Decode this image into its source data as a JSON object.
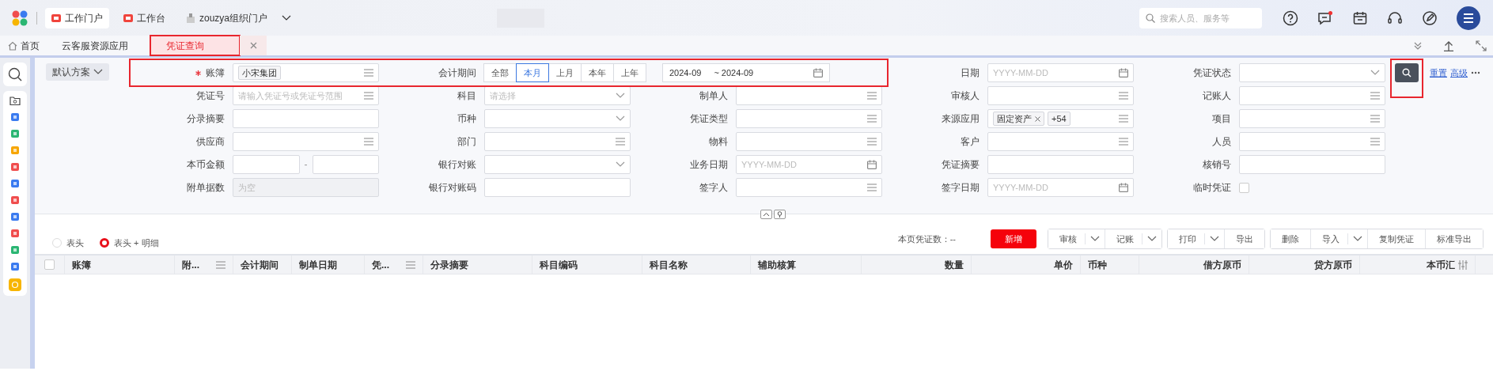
{
  "top_bar": {
    "portals": [
      {
        "label": "工作门户",
        "kind": "app",
        "selected": true
      },
      {
        "label": "工作台",
        "kind": "app",
        "selected": false
      },
      {
        "label": "zouzya组织门户",
        "kind": "org",
        "selected": false
      }
    ],
    "search": {
      "placeholder": "搜索人员、服务等"
    },
    "messages_unread": true
  },
  "tabs": [
    {
      "label": "首页",
      "kind": "home",
      "selected": false,
      "highlighted": false,
      "closable": false
    },
    {
      "label": "云客服资源应用",
      "kind": "page",
      "selected": false,
      "highlighted": false,
      "closable": false
    },
    {
      "label": "凭证查询",
      "kind": "page",
      "selected": true,
      "highlighted": true,
      "closable": true
    }
  ],
  "scheme": {
    "label": "默认方案"
  },
  "filters": [
    {
      "label": "账簿",
      "kind": "list",
      "required": true,
      "highlighted": true,
      "tags": [
        "小宋集团"
      ]
    },
    {
      "label": "会计期间",
      "kind": "period",
      "highlighted": true,
      "options": [
        {
          "label": "全部",
          "selected": false
        },
        {
          "label": "本月",
          "selected": true
        },
        {
          "label": "上月",
          "selected": false
        },
        {
          "label": "本年",
          "selected": false
        },
        {
          "label": "上年",
          "selected": false
        }
      ],
      "from": "2024-09",
      "separator": "~",
      "to": "2024-09"
    },
    {
      "label": "日期",
      "kind": "date",
      "placeholder": "YYYY-MM-DD"
    },
    {
      "label": "凭证状态",
      "kind": "select"
    },
    {
      "label": "凭证号",
      "kind": "list",
      "placeholder": "请输入凭证号或凭证号范围"
    },
    {
      "label": "科目",
      "kind": "select",
      "placeholder": "请选择"
    },
    {
      "label": "制单人",
      "kind": "list"
    },
    {
      "label": "审核人",
      "kind": "list"
    },
    {
      "label": "记账人",
      "kind": "list"
    },
    {
      "label": "分录摘要",
      "kind": "text"
    },
    {
      "label": "币种",
      "kind": "select"
    },
    {
      "label": "凭证类型",
      "kind": "list"
    },
    {
      "label": "来源应用",
      "kind": "list",
      "tags": [
        "固定资产"
      ],
      "more": "+54"
    },
    {
      "label": "项目",
      "kind": "list"
    },
    {
      "label": "供应商",
      "kind": "list"
    },
    {
      "label": "部门",
      "kind": "list"
    },
    {
      "label": "物料",
      "kind": "list"
    },
    {
      "label": "客户",
      "kind": "list"
    },
    {
      "label": "人员",
      "kind": "list"
    },
    {
      "label": "本币金额",
      "kind": "amount",
      "separator": "-"
    },
    {
      "label": "银行对账",
      "kind": "select"
    },
    {
      "label": "业务日期",
      "kind": "date",
      "placeholder": "YYYY-MM-DD"
    },
    {
      "label": "凭证摘要",
      "kind": "text"
    },
    {
      "label": "核销号",
      "kind": "text"
    },
    {
      "label": "附单据数",
      "kind": "text",
      "disabled": true,
      "placeholder": "为空"
    },
    {
      "label": "银行对账码",
      "kind": "text"
    },
    {
      "label": "签字人",
      "kind": "list"
    },
    {
      "label": "签字日期",
      "kind": "date",
      "placeholder": "YYYY-MM-DD"
    },
    {
      "label": "临时凭证",
      "kind": "checkbox",
      "checked": false
    }
  ],
  "search_button": {
    "highlighted": true
  },
  "links": [
    "重置",
    "高级"
  ],
  "view_options": [
    {
      "label": "表头",
      "selected": false
    },
    {
      "label": "表头 + 明细",
      "selected": true
    }
  ],
  "count_label": "本页凭证数：--",
  "toolbar": [
    {
      "buttons": [
        {
          "label": "新增",
          "kind": "primary",
          "dropdown": false
        }
      ]
    },
    {
      "buttons": [
        {
          "label": "审核",
          "kind": "normal",
          "dropdown": true
        },
        {
          "label": "记账",
          "kind": "normal",
          "dropdown": true
        }
      ]
    },
    {
      "buttons": [
        {
          "label": "打印",
          "kind": "normal",
          "dropdown": true
        },
        {
          "label": "导出",
          "kind": "normal",
          "dropdown": false
        }
      ]
    },
    {
      "buttons": [
        {
          "label": "删除",
          "kind": "normal",
          "dropdown": false
        },
        {
          "label": "导入",
          "kind": "normal",
          "dropdown": true
        },
        {
          "label": "复制凭证",
          "kind": "normal",
          "dropdown": false
        },
        {
          "label": "标准导出",
          "kind": "normal",
          "dropdown": false
        }
      ]
    }
  ],
  "table": {
    "select_all": {
      "checked": false
    },
    "columns": [
      {
        "label": "账簿",
        "kind": "text",
        "menu": false
      },
      {
        "label": "附...",
        "kind": "text",
        "menu": true
      },
      {
        "label": "会计期间",
        "kind": "text",
        "menu": false
      },
      {
        "label": "制单日期",
        "kind": "text",
        "menu": false
      },
      {
        "label": "凭...",
        "kind": "text",
        "menu": true
      },
      {
        "label": "分录摘要",
        "kind": "text",
        "menu": false
      },
      {
        "label": "科目编码",
        "kind": "text",
        "menu": false
      },
      {
        "label": "科目名称",
        "kind": "text",
        "menu": false
      },
      {
        "label": "辅助核算",
        "kind": "text",
        "menu": false
      },
      {
        "label": "数量",
        "kind": "number",
        "menu": false
      },
      {
        "label": "单价",
        "kind": "number",
        "menu": false
      },
      {
        "label": "币种",
        "kind": "text",
        "menu": false
      },
      {
        "label": "借方原币",
        "kind": "number",
        "menu": false
      },
      {
        "label": "贷方原币",
        "kind": "number",
        "menu": false
      },
      {
        "label": "本币汇",
        "kind": "number",
        "menu": false,
        "settings": true
      }
    ]
  }
}
